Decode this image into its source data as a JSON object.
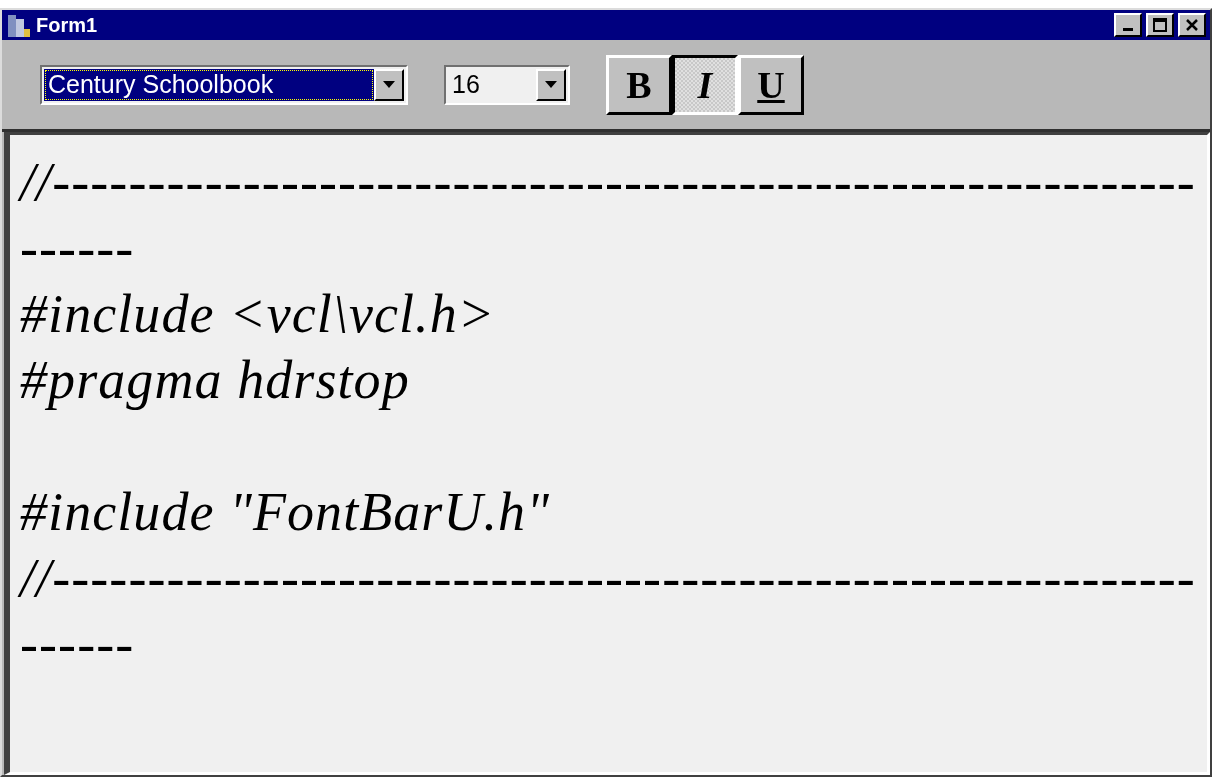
{
  "window": {
    "title": "Form1"
  },
  "toolbar": {
    "font_combo": {
      "value": "Century Schoolbook",
      "focused": true
    },
    "size_combo": {
      "value": "16"
    },
    "style_buttons": [
      {
        "label": "B",
        "kind": "bold",
        "pressed": false
      },
      {
        "label": "I",
        "kind": "italic",
        "pressed": true
      },
      {
        "label": "U",
        "kind": "underline",
        "pressed": false
      }
    ]
  },
  "memo": {
    "lines": [
      {
        "kind": "code",
        "text": "//------------------------------------------------------------------"
      },
      {
        "kind": "code",
        "text": "#include <vcl\\vcl.h>"
      },
      {
        "kind": "code",
        "text": "#pragma hdrstop"
      },
      {
        "kind": "blank"
      },
      {
        "kind": "code",
        "text": "#include \"FontBarU.h\""
      },
      {
        "kind": "code",
        "text": "//------------------------------------------------------------------"
      }
    ]
  }
}
